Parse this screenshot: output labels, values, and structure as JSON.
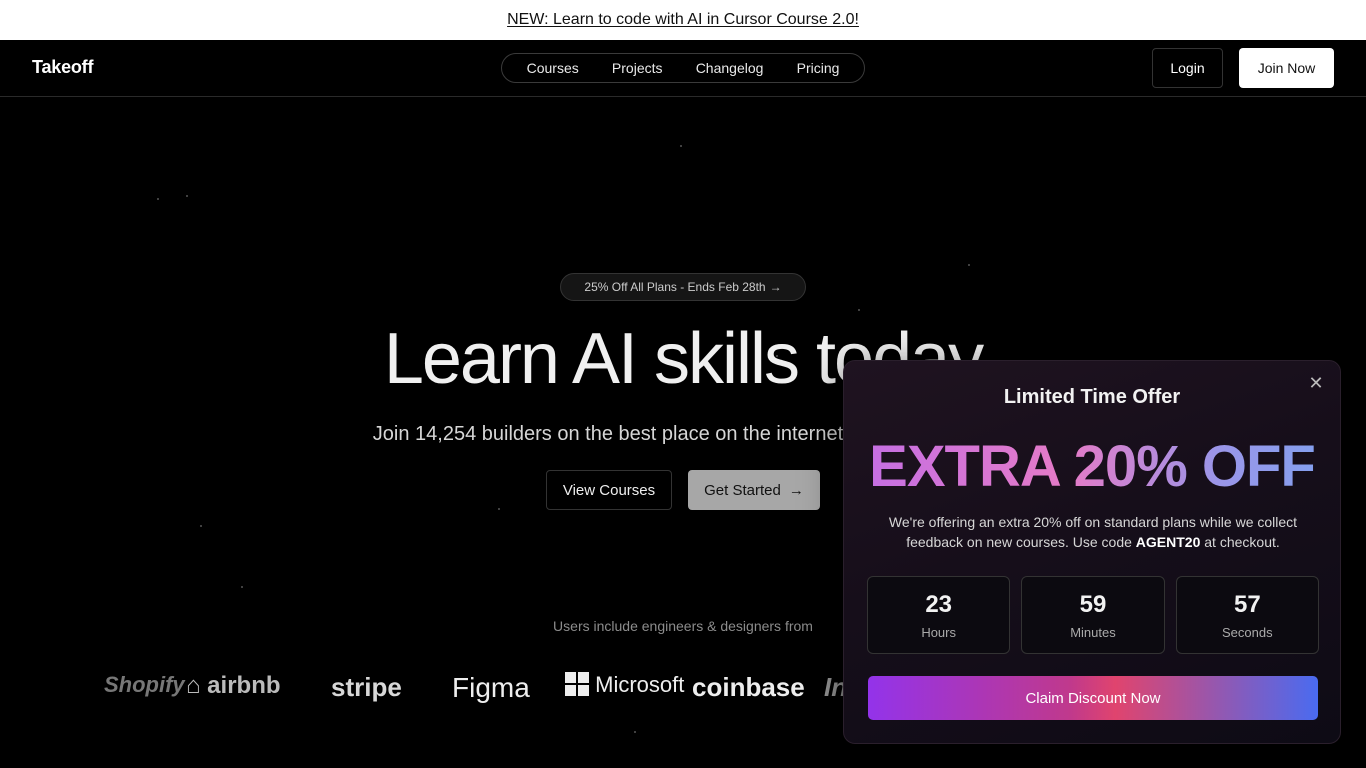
{
  "announcement": {
    "text": "NEW: Learn to code with AI in Cursor Course 2.0!"
  },
  "nav": {
    "brand": "Takeoff",
    "links": [
      "Courses",
      "Projects",
      "Changelog",
      "Pricing"
    ],
    "login": "Login",
    "join": "Join Now"
  },
  "hero": {
    "promo": "25% Off All Plans - Ends Feb 28th",
    "promo_icon": "arrow-right-icon",
    "title": "Learn AI skills today",
    "subtitle": "Join 14,254 builders on the best place on the internet to learn AI skills.",
    "view_courses": "View Courses",
    "get_started": "Get Started"
  },
  "logos": {
    "label": "Users include engineers & designers from",
    "items": [
      "Shopify",
      "airbnb",
      "stripe",
      "Figma",
      "Microsoft",
      "coinbase",
      "Instacart"
    ]
  },
  "offer": {
    "title": "Limited Time Offer",
    "headline": "EXTRA 20% OFF",
    "desc_pre": "We're offering an extra 20% off on standard plans while we collect feedback on new courses. Use code ",
    "code": "AGENT20",
    "desc_post": " at checkout.",
    "timer": [
      {
        "value": "23",
        "label": "Hours"
      },
      {
        "value": "59",
        "label": "Minutes"
      },
      {
        "value": "57",
        "label": "Seconds"
      }
    ],
    "cta": "Claim Discount Now"
  },
  "colors": {
    "accent_start": "#9333ea",
    "accent_end": "#4a6bf0",
    "background": "#000000"
  }
}
